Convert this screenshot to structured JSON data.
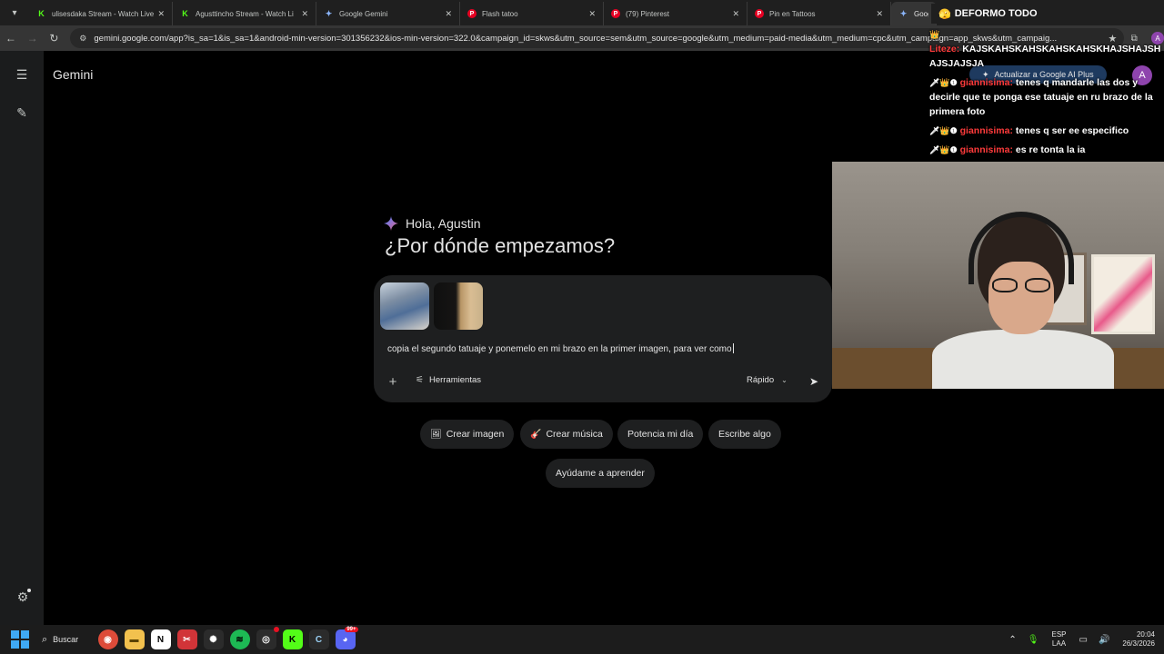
{
  "tabs": [
    {
      "label": "ulisesdaka Stream - Watch Live",
      "icon": "kick"
    },
    {
      "label": "Agusttincho Stream - Watch Li",
      "icon": "kick"
    },
    {
      "label": "Google Gemini",
      "icon": "gemini"
    },
    {
      "label": "Flash tatoo",
      "icon": "pinterest"
    },
    {
      "label": "(79) Pinterest",
      "icon": "pinterest"
    },
    {
      "label": "Pin en Tattoos",
      "icon": "pinterest"
    },
    {
      "label": "Google Ge",
      "icon": "gemini"
    }
  ],
  "address_bar": {
    "url": "gemini.google.com/app?is_sa=1&is_sa=1&android-min-version=301356232&ios-min-version=322.0&campaign_id=skws&utm_source=sem&utm_source=google&utm_medium=paid-media&utm_medium=cpc&utm_campaign=app_skws&utm_campaig..."
  },
  "gemini": {
    "brand": "Gemini",
    "upgrade_label": "Actualizar a Google AI Plus",
    "avatar_letter": "A",
    "greeting": "Hola, Agustin",
    "headline": "¿Por dónde empezamos?",
    "prompt_text": "copia el segundo tatuaje y ponemelo en mi brazo en la primer imagen, para ver como",
    "tools_label": "Herramientas",
    "mode_label": "Rápido",
    "chips": [
      {
        "label": "Crear imagen",
        "icon": "🖼"
      },
      {
        "label": "Crear música",
        "icon": "🎸"
      },
      {
        "label": "Potencia mi día",
        "icon": ""
      },
      {
        "label": "Escribe algo",
        "icon": ""
      },
      {
        "label": "Ayúdame a aprender",
        "icon": ""
      }
    ]
  },
  "stream": {
    "banner_user": "",
    "banner_text": "DEFORMO TODO",
    "chat": [
      {
        "user": "Liteze:",
        "text": "KAJSKAHSKAHSKAHSKAHSKHAJSHAJSHAJSJAJSJA",
        "badges": false
      },
      {
        "user": "giannisima:",
        "text": "tenes q mandarle las dos y decirle que te ponga ese tatuaje en ru brazo de la primera foto",
        "badges": true
      },
      {
        "user": "giannisima:",
        "text": "tenes q ser ee especifico",
        "badges": true
      },
      {
        "user": "giannisima:",
        "text": "es re tonta la ia",
        "badges": true
      }
    ]
  },
  "taskbar": {
    "search_label": "Buscar",
    "badge_count": "99+",
    "lang_top": "ESP",
    "lang_bottom": "LAA",
    "time": "20:04",
    "date": "26/3/2026"
  },
  "colors": {
    "accent_blue": "#8ab4f8",
    "chat_user": "#ff3b3b",
    "kick_green": "#53fc18",
    "pinterest_red": "#e60023"
  }
}
